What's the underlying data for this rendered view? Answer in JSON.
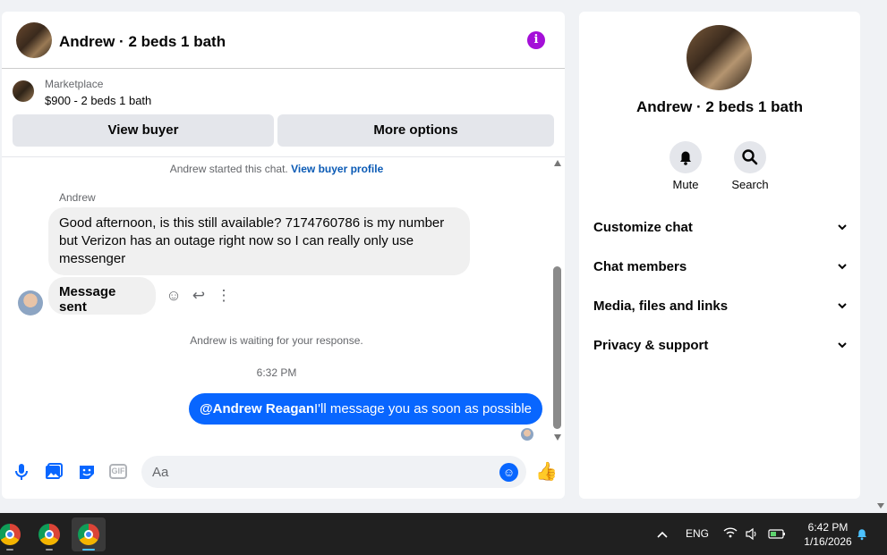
{
  "chat": {
    "title": "Andrew · 2 beds 1 bath",
    "info_icon": "i",
    "listing": {
      "category": "Marketplace",
      "price_title": "$900 - 2 beds 1 bath",
      "view_buyer_label": "View buyer",
      "more_options_label": "More options"
    },
    "started_text": "Andrew started this chat.",
    "view_buyer_profile_link": "View buyer profile",
    "sender_name": "Andrew",
    "incoming_message": "Good afternoon, is this still available? 7174760786 is my number but Verizon has an outage right now so I can really only use messenger",
    "message_sent_label": "Message sent",
    "waiting_text": "Andrew is waiting for your response.",
    "timestamp": "6:32 PM",
    "outgoing_mention": "@Andrew Reagan",
    "outgoing_text": "I'll message you as soon as possible",
    "composer": {
      "placeholder": "Aa",
      "gif_label": "GIF"
    }
  },
  "side": {
    "title": "Andrew · 2 beds 1 bath",
    "actions": [
      {
        "label": "Mute",
        "icon": "bell-icon"
      },
      {
        "label": "Search",
        "icon": "search-icon"
      }
    ],
    "sections": [
      {
        "label": "Customize chat"
      },
      {
        "label": "Chat members"
      },
      {
        "label": "Media, files and links"
      },
      {
        "label": "Privacy & support"
      }
    ]
  },
  "taskbar": {
    "language": "ENG",
    "time": "6:42 PM",
    "date": "1/16/2026"
  },
  "colors": {
    "accent": "#0866ff",
    "info": "#a40fd8",
    "link": "#0a5ab5"
  }
}
